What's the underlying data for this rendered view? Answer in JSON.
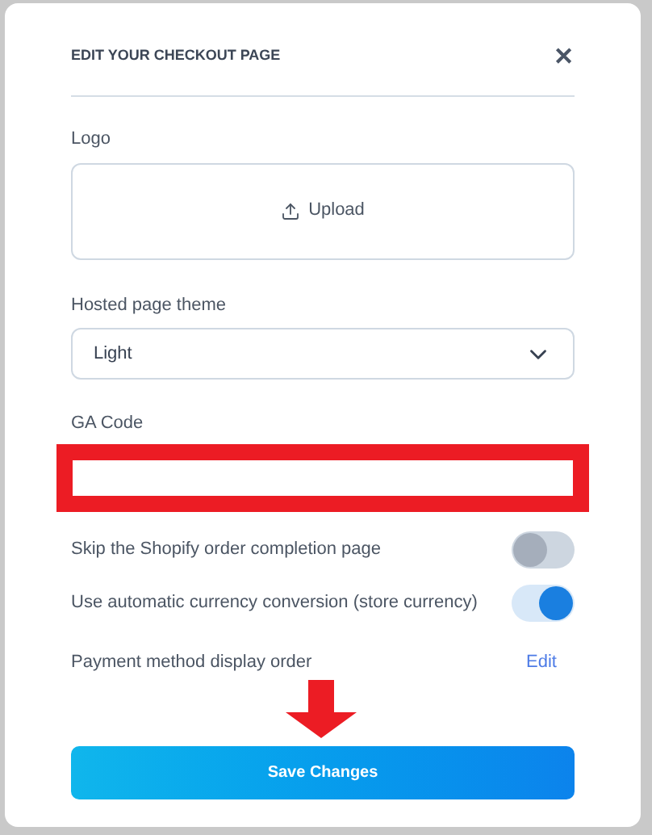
{
  "dialog": {
    "title": "EDIT YOUR CHECKOUT PAGE",
    "close": "✕"
  },
  "logo": {
    "label": "Logo",
    "button": "Upload"
  },
  "theme": {
    "label": "Hosted page theme",
    "value": "Light"
  },
  "ga_code": {
    "label": "GA Code"
  },
  "toggles": [
    {
      "label": "Skip the Shopify order completion page",
      "on": false
    },
    {
      "label": "Use automatic currency conversion (store currency)",
      "on": true
    }
  ],
  "payment_order": {
    "label": "Payment method display order",
    "link": "Edit"
  },
  "save_button": "Save Changes",
  "annotations": {
    "ga_code_box": true,
    "save_arrow": true
  }
}
